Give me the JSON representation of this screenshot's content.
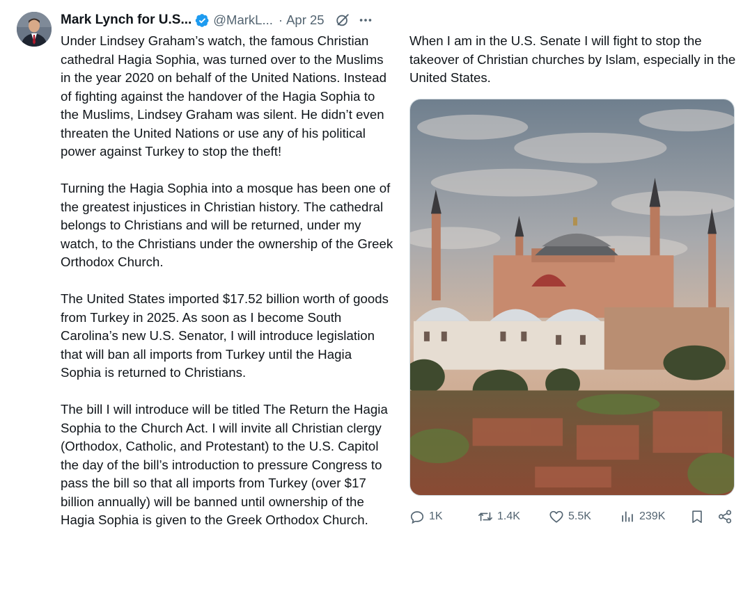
{
  "author": {
    "name": "Mark Lynch for U.S...",
    "handle": "@MarkL...",
    "separator": "·",
    "date": "Apr 25"
  },
  "icons": {
    "verified": "verified-badge-icon",
    "grok": "grok-icon",
    "more": "more-options-icon",
    "reply": "reply-icon",
    "repost": "repost-icon",
    "like": "like-icon",
    "views": "views-icon",
    "bookmark": "bookmark-icon",
    "share": "share-icon"
  },
  "colors": {
    "text": "#0f1419",
    "secondary": "#536471",
    "verified": "#1d9bf0"
  },
  "post": {
    "paragraphs": [
      "Under Lindsey Graham’s watch, the famous Christian cathedral Hagia Sophia, was turned over to the Muslims in the year 2020 on behalf of the United Nations. Instead of fighting against the handover of the Hagia Sophia to the Muslims, Lindsey Graham was silent. He didn’t even threaten the United Nations or use any of his political power against Turkey to stop the theft!",
      "Turning the Hagia Sophia into a mosque has been one of the greatest injustices in Christian history. The cathedral belongs to Christians and will be returned, under my watch, to the Christians under the ownership of the Greek Orthodox Church.",
      "The United States imported $17.52 billion worth of goods from Turkey in 2025. As soon as I become South Carolina’s new U.S. Senator, I will introduce legislation that will ban all imports from Turkey until the Hagia Sophia is returned to Christians.",
      "The bill I will introduce will be titled The Return the Hagia Sophia to the Church Act. I will invite all Christian clergy (Orthodox, Catholic, and Protestant) to the U.S. Capitol the day of the bill’s introduction to pressure Congress to pass the bill so that all imports from Turkey (over $17 billion annually) will be banned until ownership of the Hagia Sophia is given to the Greek Orthodox Church."
    ],
    "continuation": "When I am in the U.S. Senate I will fight to stop the takeover of Christian churches by Islam, especially in the United States."
  },
  "engagement": {
    "replies": "1K",
    "reposts": "1.4K",
    "likes": "5.5K",
    "views": "239K"
  }
}
